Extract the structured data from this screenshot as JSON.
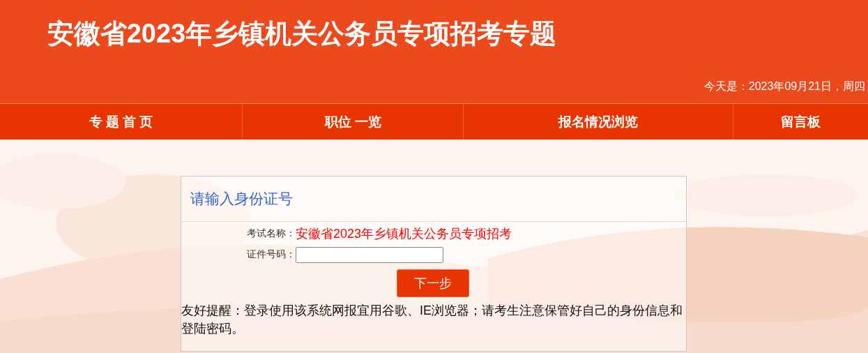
{
  "header": {
    "title": "安徽省2023年乡镇机关公务员专项招考专题",
    "date": "今天是：2023年09月21日，周四"
  },
  "nav": [
    {
      "label": "专 题 首 页"
    },
    {
      "label": "职位 一览"
    },
    {
      "label": "报名情况浏览"
    },
    {
      "label": "留言板"
    }
  ],
  "panel": {
    "title": "请输入身份证号",
    "fields": [
      {
        "kind": "text",
        "label": "考试名称：",
        "value": "安徽省2023年乡镇机关公务员专项招考"
      },
      {
        "kind": "input",
        "label": "证件号码："
      }
    ],
    "button": "下一步",
    "notice": "友好提醒：登录使用该系统网报宜用谷歌、IE浏览器；请考生注意保管好自己的身份信息和登陆密码。"
  }
}
